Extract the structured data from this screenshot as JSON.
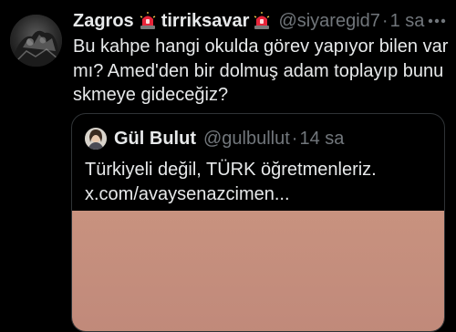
{
  "tweet": {
    "author_name": "Zagros",
    "badge_text": "tirriksavar",
    "handle": "@siyaregid7",
    "separator": "·",
    "time": "1 sa",
    "text": "Bu kahpe hangi okulda görev yapıyor bilen var mı? Amed'den bir dolmuş adam toplayıp bunu skmeye gideceğiz?",
    "badge_emoji_icon": "police-light-icon",
    "more_icon": "more-options-icon"
  },
  "quoted_tweet": {
    "author_name": "Gül Bulut",
    "handle": "@gulbullut",
    "separator": "·",
    "time": "14 sa",
    "text": "Türkiyeli değil, TÜRK öğretmenleriz. x.com/avaysenazcimen..."
  },
  "colors": {
    "background": "#000000",
    "primary_text": "#e7e9ea",
    "secondary_text": "#71767b",
    "border": "#2f3336",
    "media_fill": "#c9917e"
  }
}
